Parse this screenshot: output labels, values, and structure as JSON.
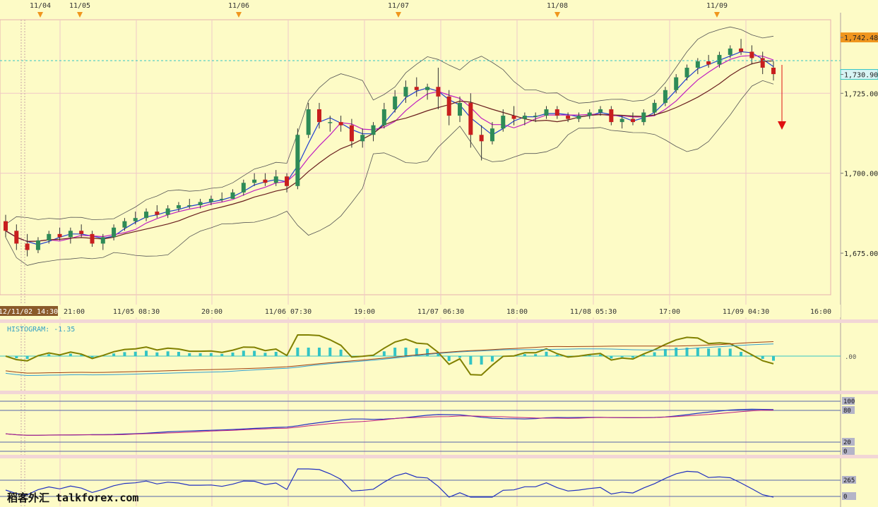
{
  "top_dates": [
    "11/04",
    "11/05",
    "11/06",
    "11/07",
    "11/08",
    "11/09"
  ],
  "price_labels": [
    {
      "value": 1742.48,
      "text": "1,742.48",
      "style": "orange"
    },
    {
      "value": 1730.9,
      "text": "1,730.90",
      "style": "cyan"
    },
    {
      "value": 1725.0,
      "text": "1,725.00",
      "style": "plain"
    },
    {
      "value": 1700.0,
      "text": "1,700.00",
      "style": "plain"
    },
    {
      "value": 1675.0,
      "text": "1,675.00",
      "style": "plain"
    }
  ],
  "x_axis_labels": [
    "12/11/02 14:30",
    "21:00",
    "11/05 08:30",
    "20:00",
    "11/06 07:30",
    "19:00",
    "11/07 06:30",
    "18:00",
    "11/08 05:30",
    "17:00",
    "11/09 04:30",
    "16:00"
  ],
  "histogram_label": "HISTOGRAM: -1.35",
  "histogram_axis_label": ".00",
  "stoch_levels": [
    "100",
    "80",
    "20",
    "0"
  ],
  "cci_levels": [
    "265",
    "0"
  ],
  "watermark": "稻客外汇 talkforex.com",
  "colors": {
    "background": "#fdfbc6",
    "up": "#2e8b57",
    "down": "#c81e1e",
    "grid": "#f0c8c8",
    "accent": "#f0961e",
    "histogram": "#33c4c4",
    "arrow": "#e01010"
  },
  "chart_data": {
    "type": "candlestick",
    "price_range": [
      1662,
      1748
    ],
    "current_price": 1730.9,
    "high_marker": 1742.48,
    "candles_ohlc": [
      [
        1685,
        1687,
        1680,
        1682
      ],
      [
        1682,
        1684,
        1676,
        1678
      ],
      [
        1678,
        1681,
        1674,
        1676
      ],
      [
        1676,
        1680,
        1675,
        1679
      ],
      [
        1679,
        1682,
        1678,
        1681
      ],
      [
        1681,
        1683,
        1679,
        1680
      ],
      [
        1680,
        1683,
        1678,
        1682
      ],
      [
        1682,
        1684,
        1680,
        1681
      ],
      [
        1681,
        1682,
        1677,
        1678
      ],
      [
        1678,
        1681,
        1676,
        1680
      ],
      [
        1680,
        1684,
        1679,
        1683
      ],
      [
        1683,
        1686,
        1682,
        1685
      ],
      [
        1685,
        1688,
        1684,
        1686
      ],
      [
        1686,
        1689,
        1685,
        1688
      ],
      [
        1688,
        1690,
        1686,
        1687
      ],
      [
        1687,
        1690,
        1686,
        1689
      ],
      [
        1689,
        1691,
        1688,
        1690
      ],
      [
        1690,
        1692,
        1689,
        1690
      ],
      [
        1690,
        1692,
        1689,
        1691
      ],
      [
        1691,
        1693,
        1690,
        1692
      ],
      [
        1692,
        1694,
        1691,
        1692
      ],
      [
        1692,
        1695,
        1692,
        1694
      ],
      [
        1694,
        1698,
        1693,
        1697
      ],
      [
        1697,
        1700,
        1696,
        1698
      ],
      [
        1698,
        1700,
        1696,
        1697
      ],
      [
        1697,
        1701,
        1696,
        1699
      ],
      [
        1699,
        1700,
        1694,
        1696
      ],
      [
        1696,
        1714,
        1695,
        1712
      ],
      [
        1712,
        1722,
        1711,
        1720
      ],
      [
        1720,
        1722,
        1714,
        1716
      ],
      [
        1716,
        1718,
        1713,
        1716
      ],
      [
        1716,
        1718,
        1713,
        1715
      ],
      [
        1715,
        1717,
        1708,
        1710
      ],
      [
        1710,
        1714,
        1708,
        1712
      ],
      [
        1712,
        1716,
        1710,
        1715
      ],
      [
        1715,
        1722,
        1714,
        1720
      ],
      [
        1720,
        1726,
        1719,
        1724
      ],
      [
        1724,
        1729,
        1722,
        1727
      ],
      [
        1727,
        1730,
        1724,
        1726
      ],
      [
        1726,
        1728,
        1723,
        1727
      ],
      [
        1727,
        1733,
        1720,
        1724
      ],
      [
        1724,
        1726,
        1715,
        1718
      ],
      [
        1718,
        1724,
        1716,
        1722
      ],
      [
        1722,
        1725,
        1708,
        1712
      ],
      [
        1712,
        1715,
        1704,
        1710
      ],
      [
        1710,
        1716,
        1709,
        1714
      ],
      [
        1714,
        1720,
        1713,
        1718
      ],
      [
        1718,
        1721,
        1715,
        1717
      ],
      [
        1717,
        1719,
        1715,
        1718
      ],
      [
        1718,
        1719,
        1716,
        1718
      ],
      [
        1718,
        1721,
        1717,
        1720
      ],
      [
        1720,
        1721,
        1717,
        1718
      ],
      [
        1718,
        1719,
        1716,
        1717
      ],
      [
        1717,
        1719,
        1716,
        1718
      ],
      [
        1718,
        1720,
        1717,
        1719
      ],
      [
        1719,
        1721,
        1718,
        1720
      ],
      [
        1720,
        1721,
        1715,
        1716
      ],
      [
        1716,
        1718,
        1714,
        1717
      ],
      [
        1717,
        1719,
        1715,
        1716
      ],
      [
        1716,
        1720,
        1715,
        1719
      ],
      [
        1719,
        1723,
        1718,
        1722
      ],
      [
        1722,
        1727,
        1721,
        1726
      ],
      [
        1726,
        1731,
        1725,
        1730
      ],
      [
        1730,
        1734,
        1729,
        1733
      ],
      [
        1733,
        1736,
        1731,
        1735
      ],
      [
        1735,
        1737,
        1733,
        1734
      ],
      [
        1734,
        1738,
        1733,
        1737
      ],
      [
        1737,
        1740,
        1736,
        1739
      ],
      [
        1739,
        1742,
        1737,
        1738
      ],
      [
        1738,
        1740,
        1734,
        1736
      ],
      [
        1736,
        1738,
        1731,
        1733
      ],
      [
        1733,
        1735,
        1729,
        1731
      ]
    ]
  }
}
